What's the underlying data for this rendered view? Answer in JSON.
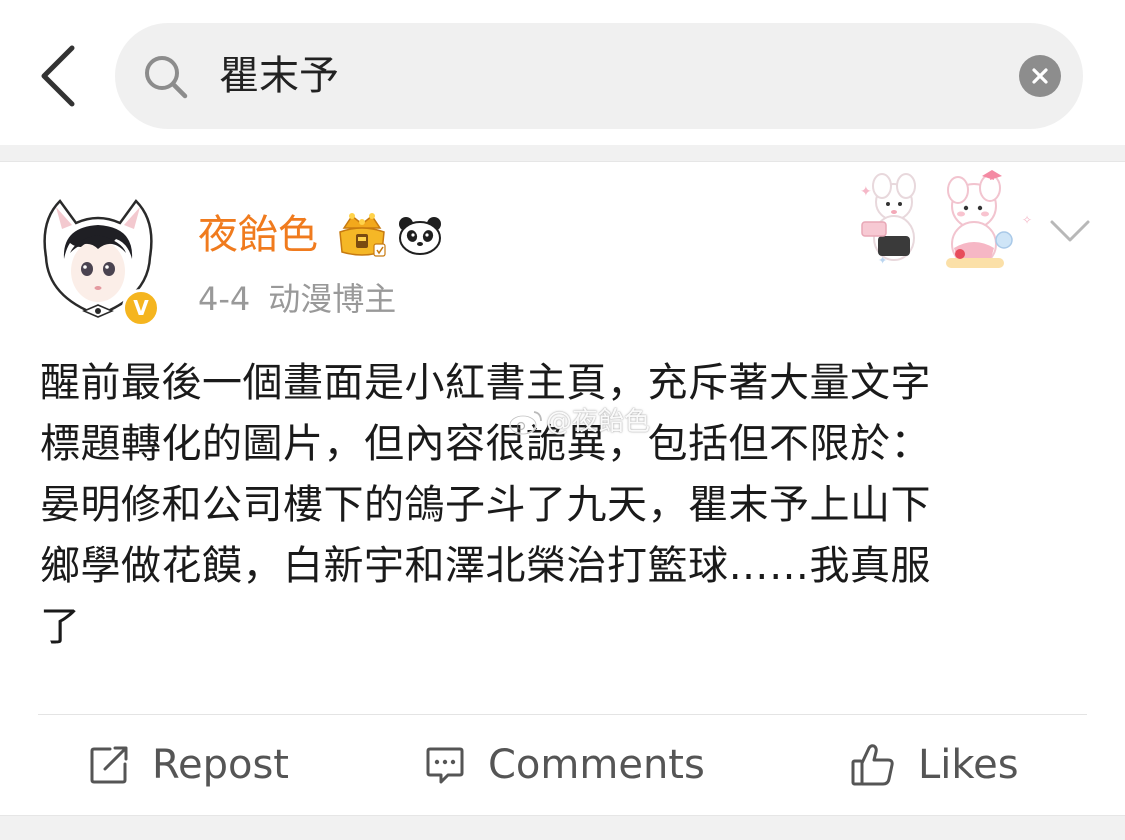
{
  "search": {
    "query": "瞿末予"
  },
  "post": {
    "author": "夜飴色",
    "date": "4-4",
    "author_tag": "动漫博主",
    "verified_label": "V",
    "body_lines": [
      "醒前最後一個畫面是小紅書主頁，充斥著大量文字",
      "標題轉化的圖片，但內容很詭異，包括但不限於：",
      "晏明修和公司樓下的鴿子斗了九天，瞿末予上山下",
      "鄉學做花饃，白新宇和澤北榮治打籃球……我真服",
      "了"
    ],
    "watermark": "@夜飴色"
  },
  "actions": {
    "repost": "Repost",
    "comments": "Comments",
    "likes": "Likes"
  },
  "colors": {
    "username": "#f07b1e",
    "verified_badge": "#f5b51f",
    "search_bg": "#f0f0f0",
    "meta_text": "#999999"
  },
  "icons": [
    "back-arrow-icon",
    "search-icon",
    "clear-icon",
    "crown-badge-icon",
    "panda-badge-icon",
    "chevron-down-icon",
    "repost-icon",
    "comment-icon",
    "like-icon"
  ]
}
